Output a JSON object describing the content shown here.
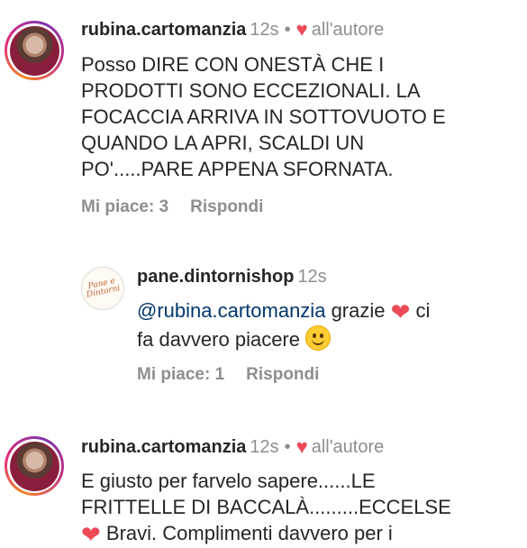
{
  "comments": [
    {
      "username": "rubina.cartomanzia",
      "time": "12s",
      "separator": "•",
      "liked_by_author_label": "all'autore",
      "text": "Posso DIRE CON ONESTÀ CHE I PRODOTTI SONO ECCEZIONALI. LA FOCACCIA ARRIVA IN SOTTOVUOTO E QUANDO LA APRI, SCALDI UN PO'.....PARE APPENA SFORNATA.",
      "likes_label": "Mi piace: 3",
      "reply_label": "Rispondi"
    },
    {
      "username": "rubina.cartomanzia",
      "time": "12s",
      "separator": "•",
      "liked_by_author_label": "all'autore",
      "text_line1": "E giusto per farvelo sapere......LE",
      "text_line2": "FRITTELLE DI BACCALÀ.........ECCELSE",
      "text_line3": "Bravi. Complimenti davvero per i"
    }
  ],
  "reply": {
    "username": "pane.dintornishop",
    "time": "12s",
    "mention": "@rubina.cartomanzia",
    "text_after_mention": "grazie",
    "text_line2": "ci",
    "text_line3": "fa davvero piacere",
    "likes_label": "Mi piace: 1",
    "reply_label": "Rispondi",
    "logo_text_1": "Pane e",
    "logo_text_2": "Dintorni"
  },
  "icons": {
    "heart": "♥",
    "heart_emoji": "❤",
    "smile_emoji": "smiling-face"
  },
  "colors": {
    "heart": "#ed4956",
    "mention": "#00376b",
    "secondary": "#8e8e8e"
  }
}
